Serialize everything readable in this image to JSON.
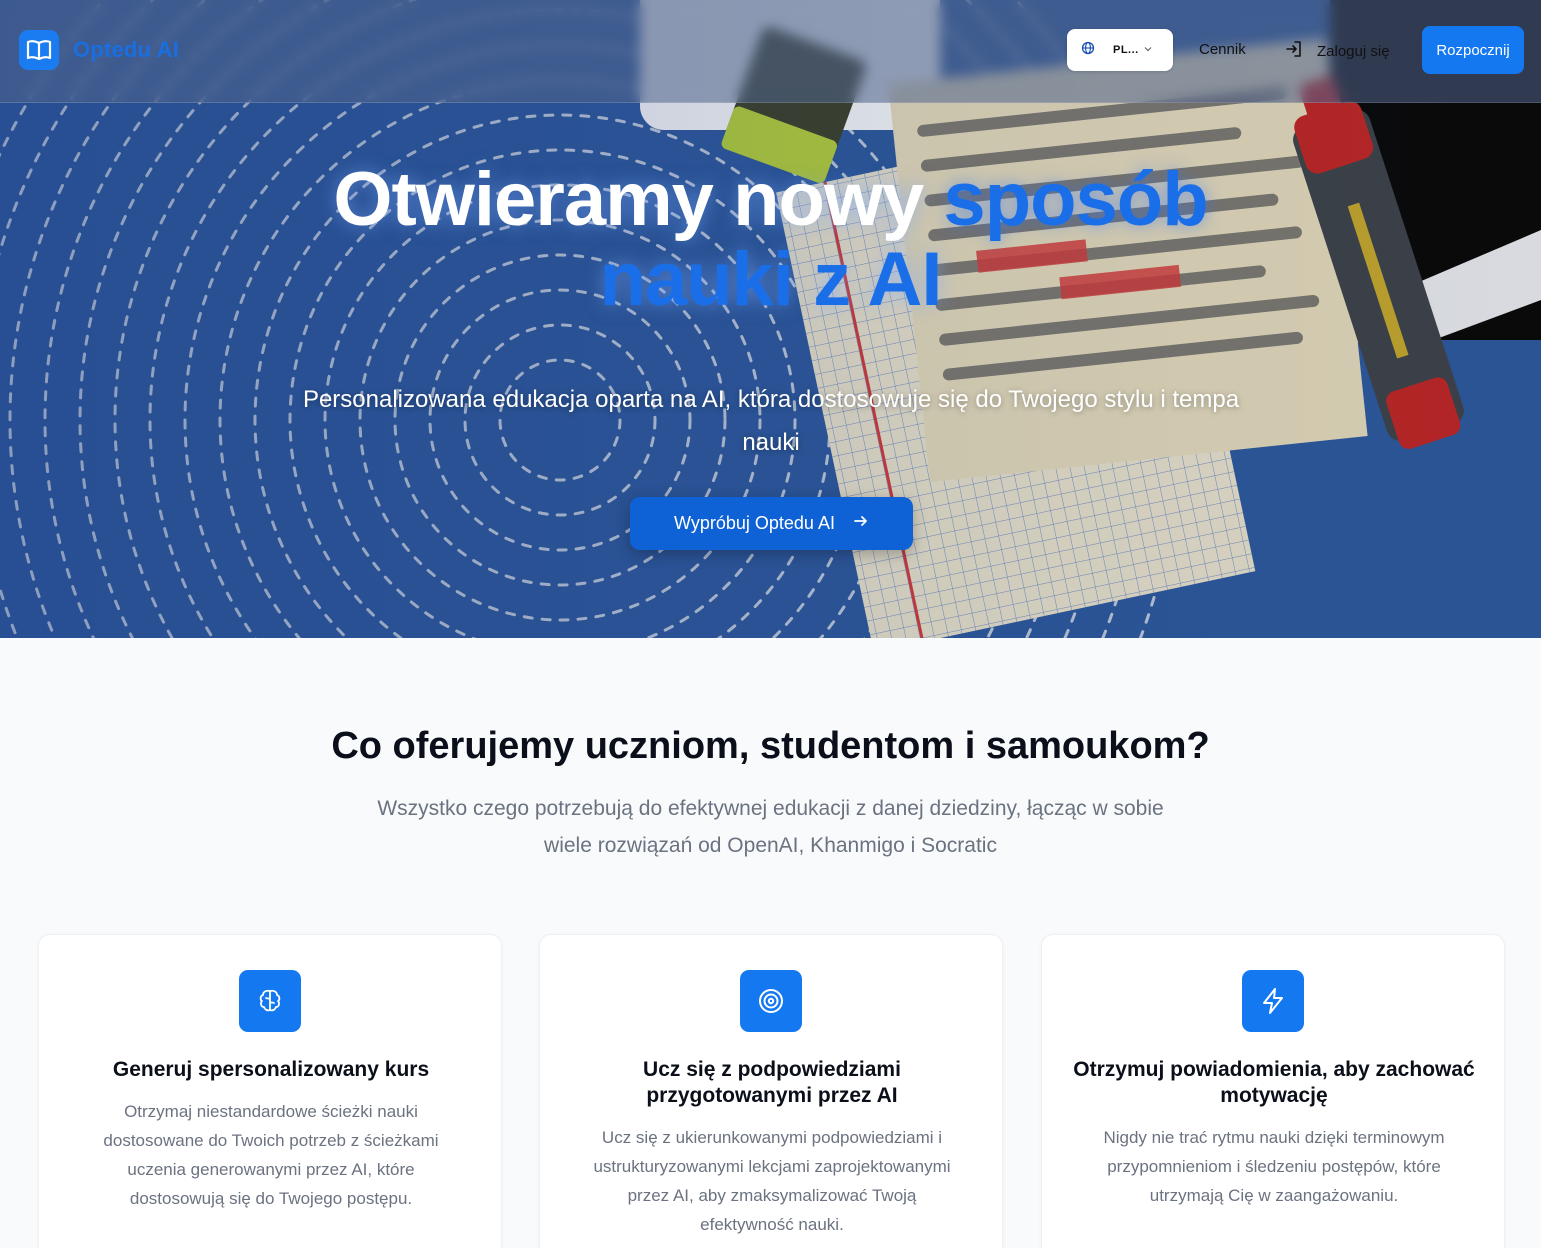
{
  "brand": {
    "name": "Optedu AI",
    "logo_icon": "open-book-icon",
    "accent": "#1479f0"
  },
  "nav": {
    "language": "PL...",
    "language_icon": "globe-icon",
    "pricing": "Cennik",
    "login": "Zaloguj się",
    "login_icon": "log-in-icon",
    "start": "Rozpocznij"
  },
  "hero": {
    "title_part1": "Otwieramy nowy ",
    "title_accent": "sposób",
    "title_line2": "nauki z AI",
    "subtitle": "Personalizowana edukacja oparta na AI, która dostosowuje się do Twojego stylu i tempa nauki",
    "cta": "Wypróbuj Optedu AI",
    "cta_icon": "arrow-right-icon"
  },
  "features": {
    "title": "Co oferujemy uczniom, studentom i samoukom?",
    "subtitle": "Wszystko czego potrzebują do efektywnej edukacji z danej dziedziny, łącząc w sobie wiele rozwiązań od OpenAI, Khanmigo i Socratic",
    "cards": [
      {
        "icon": "brain-icon",
        "title": "Generuj spersonalizowany kurs",
        "description": "Otrzymaj niestandardowe ścieżki nauki dostosowane do Twoich potrzeb z ścieżkami uczenia generowanymi przez AI, które dostosowują się do Twojego postępu."
      },
      {
        "icon": "target-icon",
        "title": "Ucz się z podpowiedziami przygotowanymi przez AI",
        "description": "Ucz się z ukierunkowanymi podpowiedziami i ustrukturyzowanymi lekcjami zaprojektowanymi przez AI, aby zmaksymalizować Twoją efektywność nauki."
      },
      {
        "icon": "lightning-icon",
        "title": "Otrzymuj powiadomienia, aby zachować motywację",
        "description": "Nigdy nie trać rytmu nauki dzięki terminowym przypomnieniom i śledzeniu postępów, które utrzymają Cię w zaangażowaniu."
      }
    ]
  }
}
